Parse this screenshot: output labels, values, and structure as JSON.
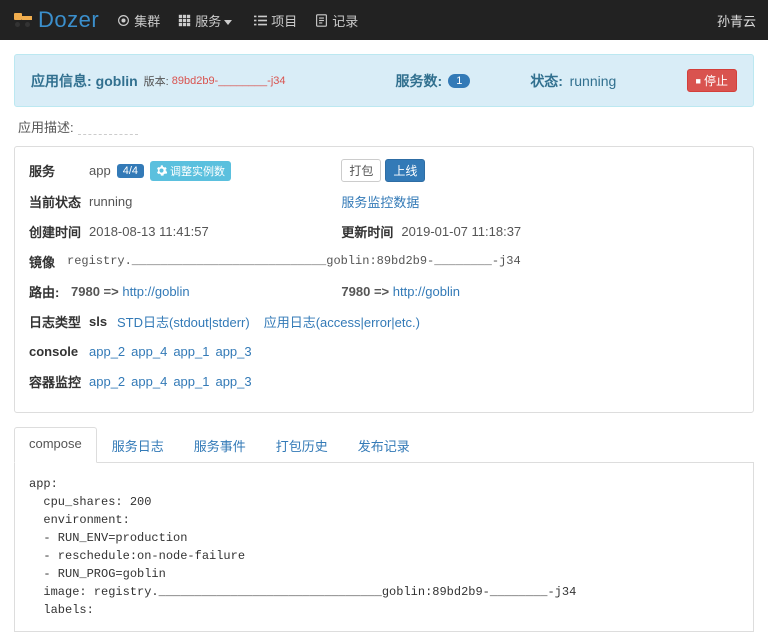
{
  "nav": {
    "brand": "Dozer",
    "items": [
      "集群",
      "服务",
      "项目",
      "记录"
    ],
    "user": "孙青云"
  },
  "infobar": {
    "app_label": "应用信息:",
    "app_name": "goblin",
    "version_label": "版本:",
    "version_value": "89bd2b9-________-j34",
    "svc_label": "服务数:",
    "svc_count": "1",
    "state_label": "状态:",
    "state_value": "running",
    "stop_label": "停止"
  },
  "desc": {
    "label": "应用描述:"
  },
  "panel": {
    "service_label": "服务",
    "service_name": "app",
    "instances": "4/4",
    "adjust_label": "调整实例数",
    "pack_btn": "打包",
    "deploy_btn": "上线",
    "status_label": "当前状态",
    "status_value": "running",
    "monitor_link": "服务监控数据",
    "created_label": "创建时间",
    "created_value": "2018-08-13 11:41:57",
    "updated_label": "更新时间",
    "updated_value": "2019-01-07 11:18:37",
    "image_label": "镜像",
    "image_value": "registry.___________________________goblin:89bd2b9-________-j34",
    "route_label": "路由:",
    "route1_port": "7980 =>",
    "route1_link": "http://goblin",
    "route2_port": "7980 =>",
    "route2_link": "http://goblin",
    "log_type_label": "日志类型",
    "log_type_value": "sls",
    "log_std_link": "STD日志(stdout|stderr)",
    "log_app_link": "应用日志(access|error|etc.)",
    "console_label": "console",
    "monitor_label": "容器监控",
    "apps": [
      "app_2",
      "app_4",
      "app_1",
      "app_3"
    ]
  },
  "tabs": {
    "items": [
      "compose",
      "服务日志",
      "服务事件",
      "打包历史",
      "发布记录"
    ]
  },
  "compose_text": "app:\n  cpu_shares: 200\n  environment:\n  - RUN_ENV=production\n  - reschedule:on-node-failure\n  - RUN_PROG=goblin\n  image: registry._______________________________goblin:89bd2b9-________-j34\n  labels:"
}
